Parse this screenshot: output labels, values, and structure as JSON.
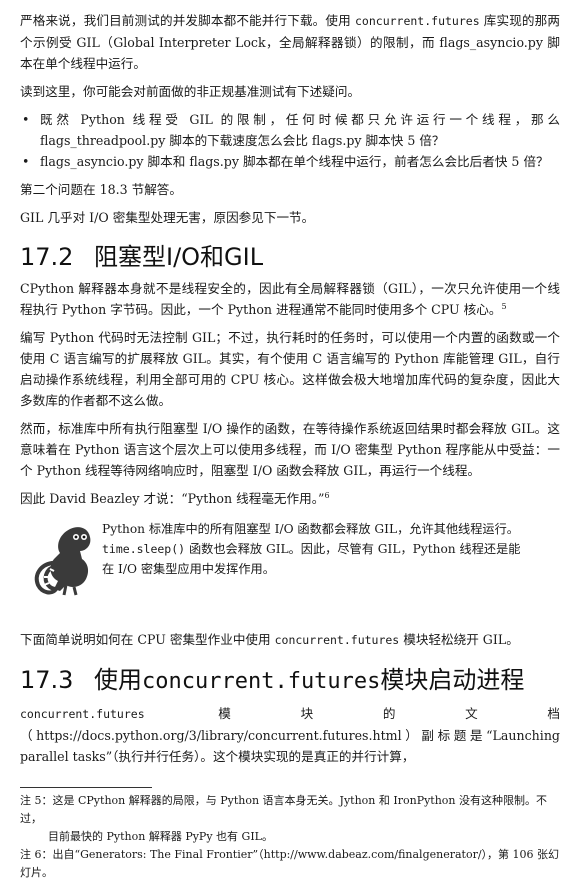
{
  "intro": {
    "p1_a": "严格来说，我们目前测试的并发脚本都不能并行下载。使用 ",
    "p1_code": "concurrent.futures",
    "p1_b": " 库实现的那两个示例受 GIL（Global Interpreter Lock，全局解释器锁）的限制，而 flags_asyncio.py 脚本在单个线程中运行。",
    "p2": "读到这里，你可能会对前面做的非正规基准测试有下述疑问。",
    "bullets": [
      "既然 Python 线程受 GIL 的限制，任何时候都只允许运行一个线程，那么 flags_threadpool.py 脚本的下载速度怎么会比 flags.py 脚本快 5 倍？",
      "flags_asyncio.py 脚本和 flags.py 脚本都在单个线程中运行，前者怎么会比后者快 5 倍？"
    ],
    "bullet_mark": "•",
    "p3": "第二个问题在 18.3 节解答。",
    "p4": "GIL 几乎对 I/O 密集型处理无害，原因参见下一节。"
  },
  "section_17_2": {
    "number": "17.2",
    "title": "阻塞型I/O和GIL",
    "p1": "CPython 解释器本身就不是线程安全的，因此有全局解释器锁（GIL），一次只允许使用一个线程执行 Python 字节码。因此，一个 Python 进程通常不能同时使用多个 CPU 核心。",
    "p1_sup": "5",
    "p2": "编写 Python 代码时无法控制 GIL；不过，执行耗时的任务时，可以使用一个内置的函数或一个使用 C 语言编写的扩展释放 GIL。其实，有个使用 C 语言编写的 Python 库能管理 GIL，自行启动操作系统线程，利用全部可用的 CPU 核心。这样做会极大地增加库代码的复杂度，因此大多数库的作者都不这么做。",
    "p3": "然而，标准库中所有执行阻塞型 I/O 操作的函数，在等待操作系统返回结果时都会释放 GIL。这意味着在 Python 语言这个层次上可以使用多线程，而 I/O 密集型 Python 程序能从中受益：一个 Python 线程等待网络响应时，阻塞型 I/O 函数会释放 GIL，再运行一个线程。",
    "p4": "因此 David Beazley 才说：“Python 线程毫无作用。”",
    "p4_sup": "6",
    "note_a": "Python 标准库中的所有阻塞型 I/O 函数都会释放 GIL，允许其他线程运行。",
    "note_code": "time.sleep()",
    "note_b": " 函数也会释放 GIL。因此，尽管有 GIL，Python 线程还是能在 I/O 密集型应用中发挥作用。",
    "note_icon": "lemur-icon",
    "p5_a": "下面简单说明如何在 CPU 密集型作业中使用 ",
    "p5_code": "concurrent.futures",
    "p5_b": " 模块轻松绕开 GIL。"
  },
  "section_17_3": {
    "number": "17.3",
    "title_a": "使用",
    "title_code": "concurrent.futures",
    "title_b": "模块启动进程",
    "p1_code": "concurrent.futures",
    "p1_rest": " 模块的文档（https://docs.python.org/3/library/concurrent.futures.html）副标题是“Launching parallel tasks”（执行并行任务）。这个模块实现的是真正的并行计算，"
  },
  "footnotes": {
    "fn5_a": "注 5：这是 CPython 解释器的局限，与 Python 语言本身无关。Jython 和 IronPython 没有这种限制。不过，",
    "fn5_b": "目前最快的 Python 解释器 PyPy 也有 GIL。",
    "fn6": "注 6：出自“Generators: The Final Frontier”（http://www.dabeaz.com/finalgenerator/），第 106 张幻灯片。"
  }
}
